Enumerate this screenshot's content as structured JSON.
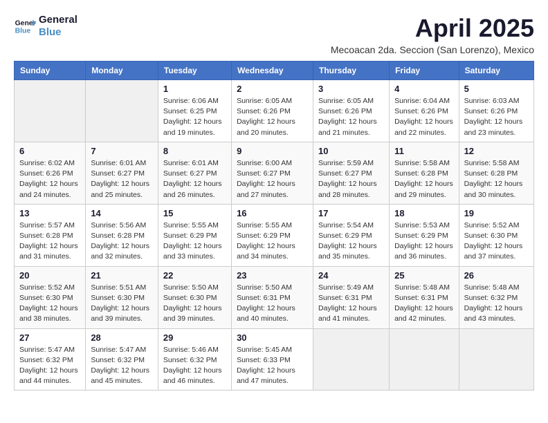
{
  "logo": {
    "line1": "General",
    "line2": "Blue"
  },
  "title": "April 2025",
  "subtitle": "Mecoacan 2da. Seccion (San Lorenzo), Mexico",
  "days_of_week": [
    "Sunday",
    "Monday",
    "Tuesday",
    "Wednesday",
    "Thursday",
    "Friday",
    "Saturday"
  ],
  "weeks": [
    [
      {
        "day": "",
        "info": ""
      },
      {
        "day": "",
        "info": ""
      },
      {
        "day": "1",
        "info": "Sunrise: 6:06 AM\nSunset: 6:25 PM\nDaylight: 12 hours and 19 minutes."
      },
      {
        "day": "2",
        "info": "Sunrise: 6:05 AM\nSunset: 6:26 PM\nDaylight: 12 hours and 20 minutes."
      },
      {
        "day": "3",
        "info": "Sunrise: 6:05 AM\nSunset: 6:26 PM\nDaylight: 12 hours and 21 minutes."
      },
      {
        "day": "4",
        "info": "Sunrise: 6:04 AM\nSunset: 6:26 PM\nDaylight: 12 hours and 22 minutes."
      },
      {
        "day": "5",
        "info": "Sunrise: 6:03 AM\nSunset: 6:26 PM\nDaylight: 12 hours and 23 minutes."
      }
    ],
    [
      {
        "day": "6",
        "info": "Sunrise: 6:02 AM\nSunset: 6:26 PM\nDaylight: 12 hours and 24 minutes."
      },
      {
        "day": "7",
        "info": "Sunrise: 6:01 AM\nSunset: 6:27 PM\nDaylight: 12 hours and 25 minutes."
      },
      {
        "day": "8",
        "info": "Sunrise: 6:01 AM\nSunset: 6:27 PM\nDaylight: 12 hours and 26 minutes."
      },
      {
        "day": "9",
        "info": "Sunrise: 6:00 AM\nSunset: 6:27 PM\nDaylight: 12 hours and 27 minutes."
      },
      {
        "day": "10",
        "info": "Sunrise: 5:59 AM\nSunset: 6:27 PM\nDaylight: 12 hours and 28 minutes."
      },
      {
        "day": "11",
        "info": "Sunrise: 5:58 AM\nSunset: 6:28 PM\nDaylight: 12 hours and 29 minutes."
      },
      {
        "day": "12",
        "info": "Sunrise: 5:58 AM\nSunset: 6:28 PM\nDaylight: 12 hours and 30 minutes."
      }
    ],
    [
      {
        "day": "13",
        "info": "Sunrise: 5:57 AM\nSunset: 6:28 PM\nDaylight: 12 hours and 31 minutes."
      },
      {
        "day": "14",
        "info": "Sunrise: 5:56 AM\nSunset: 6:28 PM\nDaylight: 12 hours and 32 minutes."
      },
      {
        "day": "15",
        "info": "Sunrise: 5:55 AM\nSunset: 6:29 PM\nDaylight: 12 hours and 33 minutes."
      },
      {
        "day": "16",
        "info": "Sunrise: 5:55 AM\nSunset: 6:29 PM\nDaylight: 12 hours and 34 minutes."
      },
      {
        "day": "17",
        "info": "Sunrise: 5:54 AM\nSunset: 6:29 PM\nDaylight: 12 hours and 35 minutes."
      },
      {
        "day": "18",
        "info": "Sunrise: 5:53 AM\nSunset: 6:29 PM\nDaylight: 12 hours and 36 minutes."
      },
      {
        "day": "19",
        "info": "Sunrise: 5:52 AM\nSunset: 6:30 PM\nDaylight: 12 hours and 37 minutes."
      }
    ],
    [
      {
        "day": "20",
        "info": "Sunrise: 5:52 AM\nSunset: 6:30 PM\nDaylight: 12 hours and 38 minutes."
      },
      {
        "day": "21",
        "info": "Sunrise: 5:51 AM\nSunset: 6:30 PM\nDaylight: 12 hours and 39 minutes."
      },
      {
        "day": "22",
        "info": "Sunrise: 5:50 AM\nSunset: 6:30 PM\nDaylight: 12 hours and 39 minutes."
      },
      {
        "day": "23",
        "info": "Sunrise: 5:50 AM\nSunset: 6:31 PM\nDaylight: 12 hours and 40 minutes."
      },
      {
        "day": "24",
        "info": "Sunrise: 5:49 AM\nSunset: 6:31 PM\nDaylight: 12 hours and 41 minutes."
      },
      {
        "day": "25",
        "info": "Sunrise: 5:48 AM\nSunset: 6:31 PM\nDaylight: 12 hours and 42 minutes."
      },
      {
        "day": "26",
        "info": "Sunrise: 5:48 AM\nSunset: 6:32 PM\nDaylight: 12 hours and 43 minutes."
      }
    ],
    [
      {
        "day": "27",
        "info": "Sunrise: 5:47 AM\nSunset: 6:32 PM\nDaylight: 12 hours and 44 minutes."
      },
      {
        "day": "28",
        "info": "Sunrise: 5:47 AM\nSunset: 6:32 PM\nDaylight: 12 hours and 45 minutes."
      },
      {
        "day": "29",
        "info": "Sunrise: 5:46 AM\nSunset: 6:32 PM\nDaylight: 12 hours and 46 minutes."
      },
      {
        "day": "30",
        "info": "Sunrise: 5:45 AM\nSunset: 6:33 PM\nDaylight: 12 hours and 47 minutes."
      },
      {
        "day": "",
        "info": ""
      },
      {
        "day": "",
        "info": ""
      },
      {
        "day": "",
        "info": ""
      }
    ]
  ]
}
